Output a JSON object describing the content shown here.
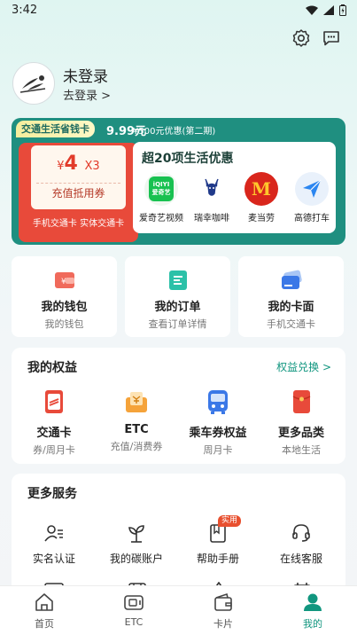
{
  "status_bar": {
    "time": "3:42"
  },
  "user": {
    "name": "未登录",
    "login_link": "去登录 >"
  },
  "promo": {
    "tag": "交通生活省钱卡",
    "price": "9.99元",
    "original": "¥500元优惠(第二期)",
    "coupon_currency": "¥",
    "coupon_amount": "4",
    "coupon_multiplier": "X3",
    "coupon_title": "充值抵用券",
    "coupon_sub": "手机交通卡 实体交通卡",
    "benefits_title": "超20项生活优惠",
    "benefits": [
      {
        "label": "爱奇艺视频",
        "logo_text": "iQIYI 爱奇艺"
      },
      {
        "label": "瑞幸咖啡"
      },
      {
        "label": "麦当劳",
        "logo_text": "M"
      },
      {
        "label": "高德打车"
      }
    ]
  },
  "quick_cards": [
    {
      "title": "我的钱包",
      "sub": "我的钱包",
      "glyph": "¥"
    },
    {
      "title": "我的订单",
      "sub": "查看订单详情"
    },
    {
      "title": "我的卡面",
      "sub": "手机交通卡"
    }
  ],
  "rights": {
    "title": "我的权益",
    "link": "权益兑换 >",
    "items": [
      {
        "title": "交通卡",
        "sub": "券/周月卡"
      },
      {
        "title": "ETC",
        "sub": "充值/消费券"
      },
      {
        "title": "乘车券权益",
        "sub": "周月卡"
      },
      {
        "title": "更多品类",
        "sub": "本地生活"
      }
    ]
  },
  "services": {
    "title": "更多服务",
    "items": [
      {
        "title": "实名认证"
      },
      {
        "title": "我的碳账户"
      },
      {
        "title": "帮助手册",
        "badge": "实用"
      },
      {
        "title": "在线客服"
      }
    ]
  },
  "tabbar": [
    {
      "label": "首页"
    },
    {
      "label": "ETC"
    },
    {
      "label": "卡片"
    },
    {
      "label": "我的",
      "active": true
    }
  ],
  "colors": {
    "accent": "#11967f",
    "promo_bg": "#1f8f80",
    "coupon_red": "#e84a3a"
  }
}
